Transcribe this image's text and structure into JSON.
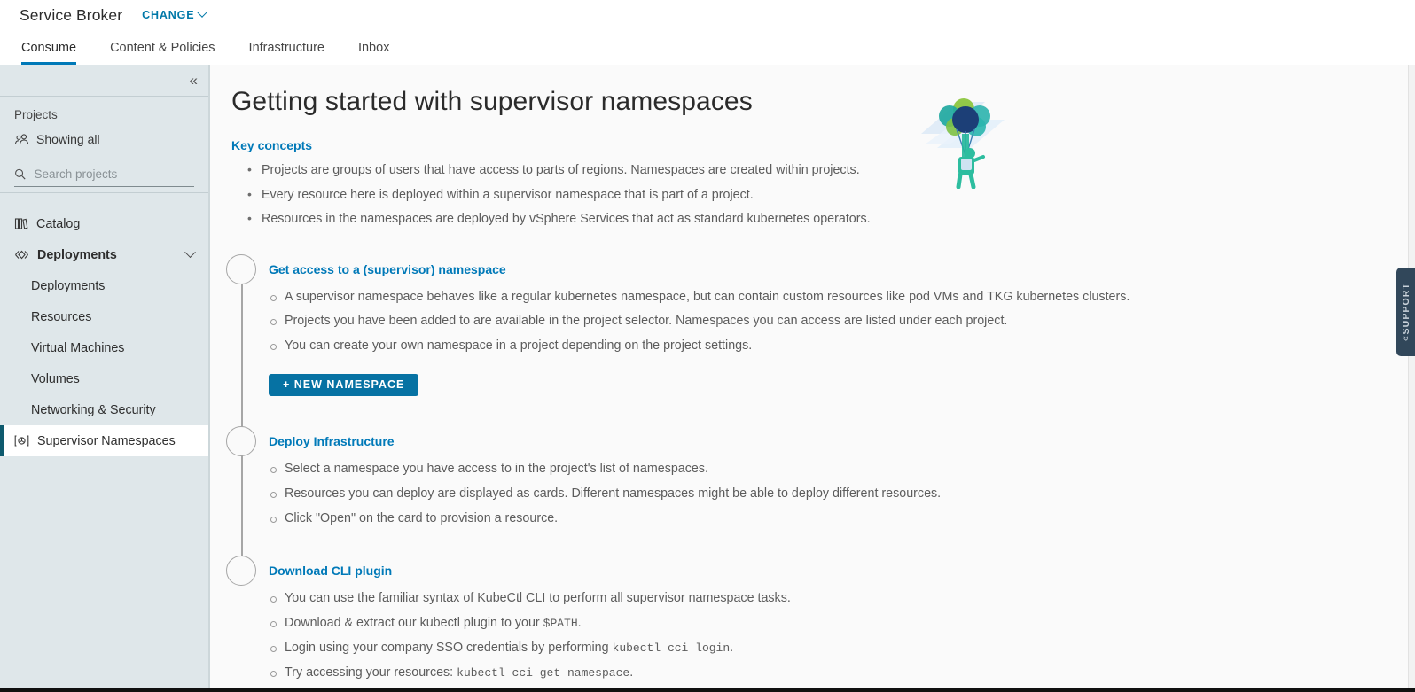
{
  "header": {
    "app_title": "Service Broker",
    "change_label": "CHANGE",
    "change_icon": "chevron-down-icon"
  },
  "tabs": [
    {
      "label": "Consume",
      "active": true
    },
    {
      "label": "Content & Policies",
      "active": false
    },
    {
      "label": "Infrastructure",
      "active": false
    },
    {
      "label": "Inbox",
      "active": false
    }
  ],
  "sidebar": {
    "collapse_icon": "double-chevron-left-icon",
    "projects_label": "Projects",
    "showing_all_label": "Showing all",
    "showing_all_icon": "users-group-icon",
    "search": {
      "icon": "search-icon",
      "placeholder": "Search projects",
      "value": ""
    },
    "nav": [
      {
        "label": "Catalog",
        "icon": "catalog-icon",
        "type": "item",
        "bold": false,
        "selected": false
      },
      {
        "label": "Deployments",
        "icon": "deployments-icon",
        "type": "item",
        "bold": true,
        "selected": false,
        "expand_icon": "chevron-down-icon"
      },
      {
        "label": "Deployments",
        "type": "sub"
      },
      {
        "label": "Resources",
        "type": "sub"
      },
      {
        "label": "Virtual Machines",
        "type": "sub"
      },
      {
        "label": "Volumes",
        "type": "sub"
      },
      {
        "label": "Networking & Security",
        "type": "sub"
      },
      {
        "label": "Supervisor Namespaces",
        "icon": "supervisor-namespace-icon",
        "type": "item",
        "bold": false,
        "selected": true
      }
    ]
  },
  "main": {
    "page_title": "Getting started with supervisor namespaces",
    "key_concepts_link": "Key concepts",
    "key_concepts": [
      "Projects are groups of users that have access to parts of regions. Namespaces are created within projects.",
      "Every resource here is deployed within a supervisor namespace that is part of a project.",
      "Resources in the namespaces are deployed by vSphere Services that act as standard kubernetes operators."
    ],
    "illustration": "balloons-parachute-illustration",
    "steps": [
      {
        "title": "Get access to a (supervisor) namespace",
        "bullets": [
          {
            "text": "A supervisor namespace behaves like a regular kubernetes namespace, but can contain custom resources like pod VMs and TKG kubernetes clusters."
          },
          {
            "text": "Projects you have been added to are available in the project selector. Namespaces you can access are listed under each project."
          },
          {
            "text": "You can create your own namespace in a project depending on the project settings."
          }
        ],
        "button": "+ NEW NAMESPACE"
      },
      {
        "title": "Deploy Infrastructure",
        "bullets": [
          {
            "text": "Select a namespace you have access to in the project's list of namespaces."
          },
          {
            "text": "Resources you can deploy are displayed as cards. Different namespaces might be able to deploy different resources."
          },
          {
            "text": "Click \"Open\" on the card to provision a resource."
          }
        ]
      },
      {
        "title": "Download CLI plugin",
        "bullets": [
          {
            "text": "You can use the familiar syntax of KubeCtl CLI to perform all supervisor namespace tasks."
          },
          {
            "text": "Download & extract our kubectl plugin to your ",
            "code": "$PATH",
            "tail": "."
          },
          {
            "text": "Login using your company SSO credentials by performing ",
            "code": "kubectl cci login",
            "tail": "."
          },
          {
            "text": "Try accessing your resources: ",
            "code": "kubectl cci get namespace",
            "tail": "."
          }
        ]
      }
    ]
  },
  "support": {
    "label": "SUPPORT",
    "icon": "double-chevron-left-icon"
  },
  "colors": {
    "accent_blue": "#0079b8",
    "button_blue": "#0672a3",
    "sidebar_bg": "#dfe7ea",
    "selected_bar": "#0e5a6e",
    "support_bg": "#31475a"
  }
}
